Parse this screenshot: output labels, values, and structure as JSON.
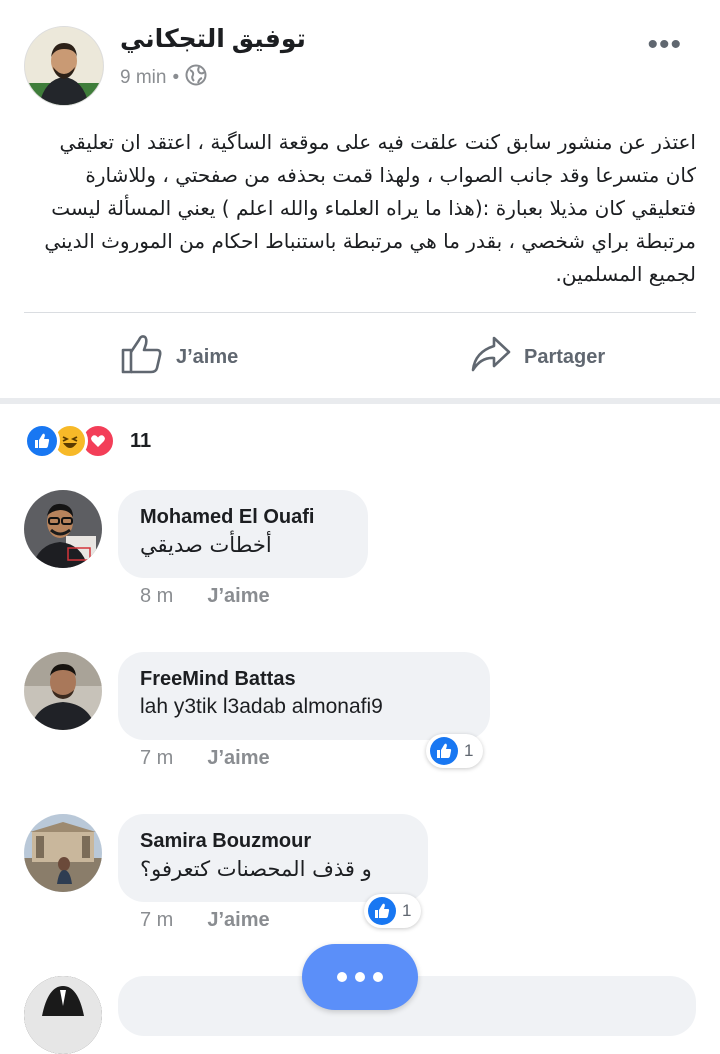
{
  "post": {
    "author": "توفيق التجكاني",
    "time": "9 min",
    "separator": "•",
    "privacy_icon": "globe-icon",
    "more_icon": "more-dots-icon",
    "text": "اعتذر عن منشور سابق كنت علقت فيه على موقعة الساگية ، اعتقد ان تعليقي كان متسرعا وقد جانب الصواب ، ولهذا قمت بحذفه من صفحتي ، وللاشارة فتعليقي كان مذيلا بعبارة :(هذا ما يراه العلماء والله اعلم ) يعني المسألة ليست مرتبطة براي شخصي ، بقدر ما هي مرتبطة باستنباط احكام من الموروث الديني لجميع المسلمين.",
    "like_label": "J’aime",
    "share_label": "Partager"
  },
  "reactions": {
    "icons": [
      "like-icon",
      "haha-icon",
      "love-icon"
    ],
    "count": "11"
  },
  "comments": [
    {
      "name": "Mohamed El Ouafi",
      "text": "أخطأت صديقي",
      "time": "8 m",
      "like_label": "J’aime",
      "reaction_count": ""
    },
    {
      "name": "FreeMind Battas",
      "text": "lah y3tik l3adab almonafi9",
      "time": "7 m",
      "like_label": "J’aime",
      "reaction_count": "1"
    },
    {
      "name": "Samira Bouzmour",
      "text": "و قذف المحصنات كتعرفو؟",
      "time": "7 m",
      "like_label": "J’aime",
      "reaction_count": "1"
    }
  ],
  "colors": {
    "brand_blue": "#1877f2",
    "fab_blue": "#5b8ff9",
    "bubble_gray": "#f0f2f5",
    "muted_text": "#8a8d91"
  }
}
